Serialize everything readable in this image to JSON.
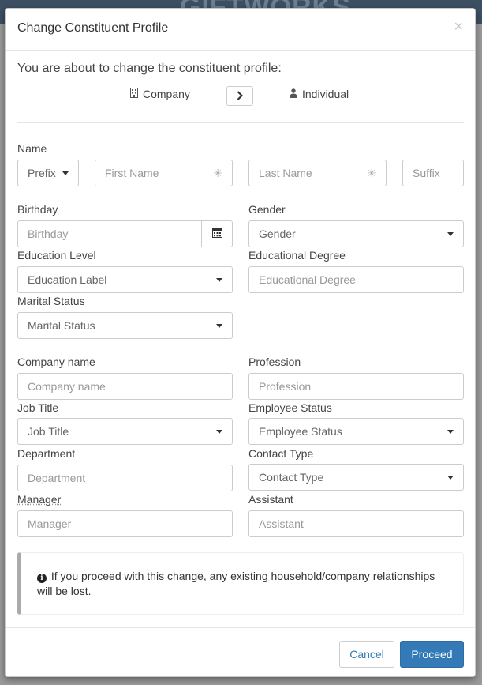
{
  "background": {
    "logo_text": "GIFTWORKS"
  },
  "modal": {
    "title": "Change Constituent Profile",
    "close_symbol": "×",
    "intro": "You are about to change the constituent profile:",
    "from_type": "Company",
    "to_type": "Individual",
    "arrow_symbol": ">"
  },
  "form": {
    "name_label": "Name",
    "prefix": "Prefix",
    "first_name_placeholder": "First Name",
    "last_name_placeholder": "Last Name",
    "suffix_placeholder": "Suffix",
    "required_symbol": "✳",
    "birthday_label": "Birthday",
    "birthday_placeholder": "Birthday",
    "gender_label": "Gender",
    "gender_value": "Gender",
    "education_level_label": "Education Level",
    "education_level_value": "Education Label",
    "educational_degree_label": "Educational Degree",
    "educational_degree_placeholder": "Educational Degree",
    "marital_status_label": "Marital Status",
    "marital_status_value": "Marital Status",
    "company_name_label": "Company name",
    "company_name_placeholder": "Company name",
    "profession_label": "Profession",
    "profession_placeholder": "Profession",
    "job_title_label": "Job Title",
    "job_title_value": "Job Title",
    "employee_status_label": "Employee Status",
    "employee_status_value": "Employee Status",
    "department_label": "Department",
    "department_placeholder": "Department",
    "contact_type_label": "Contact Type",
    "contact_type_value": "Contact Type",
    "manager_label": "Manager",
    "manager_placeholder": "Manager",
    "assistant_label": "Assistant",
    "assistant_placeholder": "Assistant"
  },
  "alert": {
    "icon_glyph": "i",
    "text": "If you proceed with this change, any existing household/company relationships will be lost."
  },
  "footer": {
    "cancel_label": "Cancel",
    "proceed_label": "Proceed"
  },
  "colors": {
    "primary": "#337ab7",
    "header_bg": "#3d4f63",
    "alert_border": "#aaaaaa"
  },
  "icons": [
    "building-icon",
    "user-icon",
    "calendar-icon",
    "info-circle-icon",
    "chevron-right-icon",
    "close-icon",
    "asterisk-icon",
    "caret-down-icon"
  ]
}
